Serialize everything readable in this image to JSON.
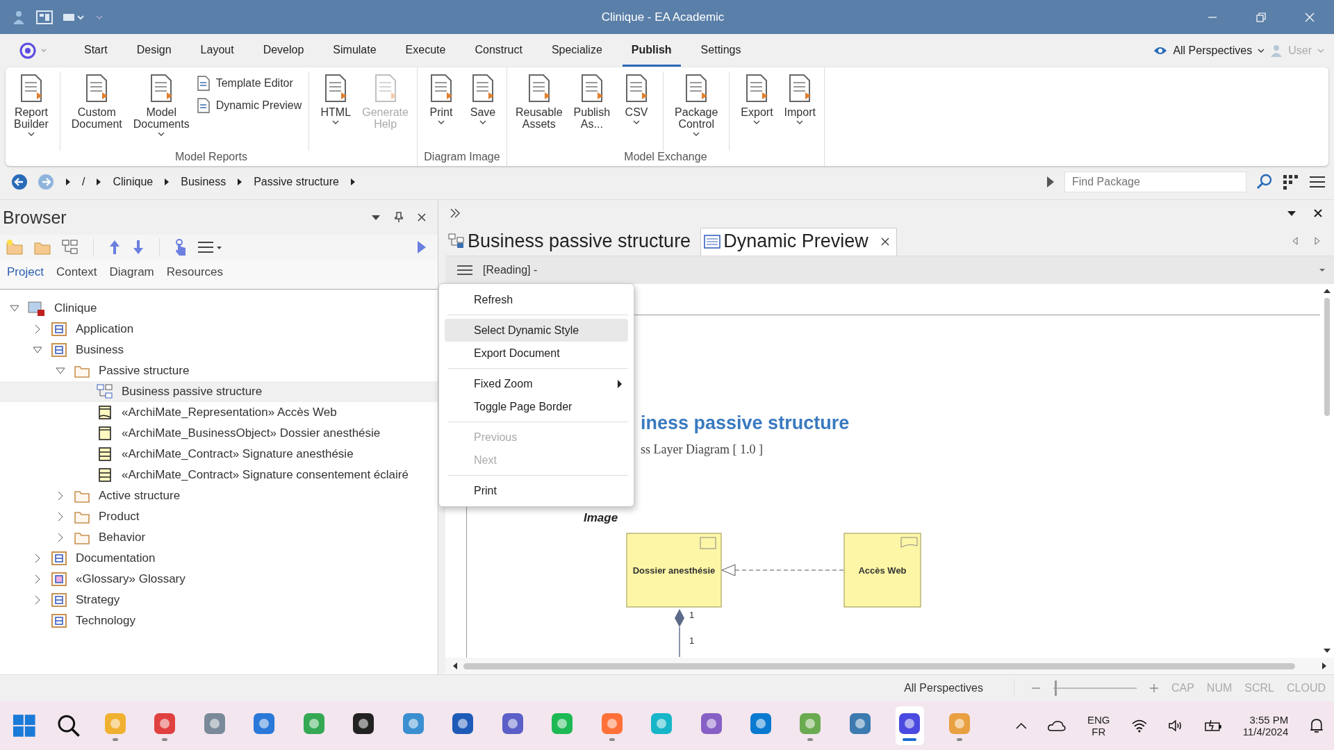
{
  "window": {
    "title": "Clinique - EA Academic"
  },
  "menu_tabs": [
    {
      "label": "Start",
      "selected": false
    },
    {
      "label": "Design",
      "selected": false
    },
    {
      "label": "Layout",
      "selected": false
    },
    {
      "label": "Develop",
      "selected": false
    },
    {
      "label": "Simulate",
      "selected": false
    },
    {
      "label": "Execute",
      "selected": false
    },
    {
      "label": "Construct",
      "selected": false
    },
    {
      "label": "Specialize",
      "selected": false
    },
    {
      "label": "Publish",
      "selected": true
    },
    {
      "label": "Settings",
      "selected": false
    }
  ],
  "perspectives": {
    "label": "All Perspectives"
  },
  "user": {
    "label": "User"
  },
  "ribbon": {
    "groups": [
      {
        "label": "Model Reports",
        "sections": [
          [
            {
              "kind": "large",
              "lines": [
                "Report",
                "Builder"
              ],
              "dropdown": true,
              "disabled": false
            }
          ],
          [
            {
              "kind": "large",
              "lines": [
                "Custom",
                "Document"
              ],
              "dropdown": false,
              "disabled": false
            },
            {
              "kind": "large",
              "lines": [
                "Model",
                "Documents"
              ],
              "dropdown": true,
              "disabled": false
            },
            {
              "kind": "small_stack",
              "entries": [
                "Template Editor",
                "Dynamic Preview"
              ]
            }
          ],
          [
            {
              "kind": "large",
              "lines": [
                "HTML"
              ],
              "dropdown": true,
              "disabled": false
            },
            {
              "kind": "large",
              "lines": [
                "Generate",
                "Help"
              ],
              "dropdown": false,
              "disabled": true
            }
          ]
        ]
      },
      {
        "label": "Diagram Image",
        "sections": [
          [
            {
              "kind": "large",
              "lines": [
                "Print"
              ],
              "dropdown": true,
              "disabled": false
            },
            {
              "kind": "large",
              "lines": [
                "Save"
              ],
              "dropdown": true,
              "disabled": false
            }
          ]
        ]
      },
      {
        "label": "Model Exchange",
        "sections": [
          [
            {
              "kind": "large",
              "lines": [
                "Reusable",
                "Assets"
              ],
              "dropdown": false,
              "disabled": false
            },
            {
              "kind": "large",
              "lines": [
                "Publish",
                "As..."
              ],
              "dropdown": false,
              "disabled": false
            },
            {
              "kind": "large",
              "lines": [
                "CSV"
              ],
              "dropdown": true,
              "disabled": false
            }
          ],
          [
            {
              "kind": "large",
              "lines": [
                "Package",
                "Control"
              ],
              "dropdown": true,
              "disabled": false
            }
          ],
          [
            {
              "kind": "large",
              "lines": [
                "Export"
              ],
              "dropdown": true,
              "disabled": false
            },
            {
              "kind": "large",
              "lines": [
                "Import"
              ],
              "dropdown": true,
              "disabled": false
            }
          ]
        ]
      }
    ]
  },
  "breadcrumb": {
    "items": [
      "/",
      "Clinique",
      "Business",
      "Passive structure"
    ],
    "find": {
      "placeholder": "Find Package"
    }
  },
  "browser": {
    "title": "Browser",
    "tabs": [
      {
        "label": "Project",
        "selected": true
      },
      {
        "label": "Context",
        "selected": false
      },
      {
        "label": "Diagram",
        "selected": false
      },
      {
        "label": "Resources",
        "selected": false
      }
    ],
    "tree": [
      {
        "label": "Clinique",
        "kind": "root",
        "expanded": true,
        "selected": false,
        "children": [
          {
            "label": "Application",
            "kind": "model",
            "expanded": false,
            "selected": false
          },
          {
            "label": "Business",
            "kind": "model",
            "expanded": true,
            "selected": false,
            "children": [
              {
                "label": "Passive structure",
                "kind": "folder",
                "expanded": true,
                "selected": false,
                "children": [
                  {
                    "label": "Business passive structure",
                    "kind": "diagram",
                    "selected": true
                  },
                  {
                    "label": "«ArchiMate_Representation» Accès Web",
                    "kind": "representation",
                    "selected": false
                  },
                  {
                    "label": "«ArchiMate_BusinessObject» Dossier anesthésie",
                    "kind": "object",
                    "selected": false
                  },
                  {
                    "label": "«ArchiMate_Contract» Signature anesthésie",
                    "kind": "contract",
                    "selected": false
                  },
                  {
                    "label": "«ArchiMate_Contract» Signature consentement éclairé",
                    "kind": "contract",
                    "selected": false
                  }
                ]
              },
              {
                "label": "Active structure",
                "kind": "folder",
                "expanded": false,
                "selected": false
              },
              {
                "label": "Product",
                "kind": "folder",
                "expanded": false,
                "selected": false
              },
              {
                "label": "Behavior",
                "kind": "folder",
                "expanded": false,
                "selected": false
              }
            ]
          },
          {
            "label": "Documentation",
            "kind": "model",
            "expanded": false,
            "selected": false
          },
          {
            "label": "«Glossary» Glossary",
            "kind": "glossary",
            "expanded": false,
            "selected": false
          },
          {
            "label": "Strategy",
            "kind": "model",
            "expanded": false,
            "selected": false
          },
          {
            "label": "Technology",
            "kind": "model",
            "selected": false
          }
        ]
      }
    ]
  },
  "doc_tabs": [
    {
      "label": "Business passive structure",
      "kind": "diagram",
      "selected": false,
      "closable": false
    },
    {
      "label": "Dynamic Preview",
      "kind": "document",
      "selected": true,
      "closable": true
    }
  ],
  "doc_toolbar": {
    "mode": "[Reading] -"
  },
  "context_menu": {
    "groups": [
      [
        {
          "label": "Refresh",
          "highlighted": false,
          "disabled": false,
          "submenu": false
        }
      ],
      [
        {
          "label": "Select Dynamic Style",
          "highlighted": true,
          "disabled": false,
          "submenu": false
        },
        {
          "label": "Export Document",
          "highlighted": false,
          "disabled": false,
          "submenu": false
        }
      ],
      [
        {
          "label": "Fixed Zoom",
          "highlighted": false,
          "disabled": false,
          "submenu": true
        },
        {
          "label": "Toggle Page Border",
          "highlighted": false,
          "disabled": false,
          "submenu": false
        }
      ],
      [
        {
          "label": "Previous",
          "highlighted": false,
          "disabled": true,
          "submenu": false
        },
        {
          "label": "Next",
          "highlighted": false,
          "disabled": true,
          "submenu": false
        }
      ],
      [
        {
          "label": "Print",
          "highlighted": false,
          "disabled": false,
          "submenu": false
        }
      ]
    ]
  },
  "document": {
    "heading": "iness passive structure",
    "subtitle": "ss Layer Diagram  [ 1.0 ]",
    "image_label": "Image",
    "diagram": {
      "nodes": [
        {
          "label": "Dossier anesthésie"
        },
        {
          "label": "Accès Web"
        }
      ],
      "multiplicities": [
        "1",
        "1"
      ]
    }
  },
  "status_bar": {
    "perspective": "All Perspectives",
    "zoom_slider": {
      "level": 0.02
    },
    "indicators": [
      {
        "label": "CAP",
        "on": false
      },
      {
        "label": "NUM",
        "on": false
      },
      {
        "label": "SCRL",
        "on": false
      },
      {
        "label": "CLOUD",
        "on": false
      }
    ]
  },
  "taskbar": {
    "apps": [
      {
        "color": "#f0b030",
        "running": true,
        "active": false
      },
      {
        "color": "#e04040",
        "running": true,
        "active": false
      },
      {
        "color": "#7a8a9a",
        "running": false,
        "active": false
      },
      {
        "color": "#2a78d8",
        "running": false,
        "active": false
      },
      {
        "color": "#34a853",
        "running": false,
        "active": false
      },
      {
        "color": "#222222",
        "running": false,
        "active": false
      },
      {
        "color": "#3a8fd0",
        "running": false,
        "active": false
      },
      {
        "color": "#1e5bb8",
        "running": false,
        "active": false
      },
      {
        "color": "#5b5fc7",
        "running": false,
        "active": false
      },
      {
        "color": "#1db954",
        "running": false,
        "active": false
      },
      {
        "color": "#ff7139",
        "running": true,
        "active": false
      },
      {
        "color": "#16b5c8",
        "running": false,
        "active": false
      },
      {
        "color": "#8660c5",
        "running": false,
        "active": false
      },
      {
        "color": "#0a7ad0",
        "running": false,
        "active": false
      },
      {
        "color": "#6aaa50",
        "running": true,
        "active": false
      },
      {
        "color": "#3c7ab0",
        "running": false,
        "active": false
      },
      {
        "color": "#4a4ae0",
        "running": true,
        "active": true
      },
      {
        "color": "#e8a040",
        "running": true,
        "active": false
      }
    ],
    "language": [
      "ENG",
      "FR"
    ],
    "time": "3:55 PM",
    "date": "11/4/2024"
  }
}
